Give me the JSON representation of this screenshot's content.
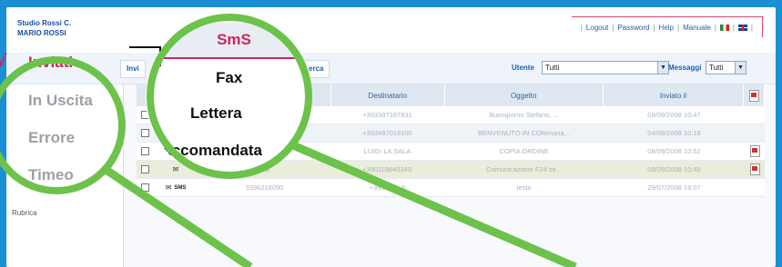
{
  "header": {
    "company_line1": "Studio Rossi C.",
    "company_line2": "MARIO ROSSI",
    "nav": [
      "Logout",
      "Password",
      "Help",
      "Manuale"
    ]
  },
  "tabs": {
    "partial_left": "Invi",
    "partial_right": "erca"
  },
  "filters": {
    "utente_label": "Utente",
    "utente_value": "Tutti",
    "messaggi_label": "Messaggi",
    "messaggi_value": "Tutti"
  },
  "sidebar": {
    "rubrica": "Rubrica"
  },
  "left_menu": {
    "items": [
      "Inviati",
      "In Uscita",
      "Errore",
      "Timeo"
    ]
  },
  "type_menu": {
    "items": [
      "SmS",
      "Fax",
      "Lettera",
      "Raccomandata"
    ]
  },
  "table": {
    "headers": [
      "Destinatario",
      "Oggetto",
      "Inviato il"
    ],
    "rows": [
      {
        "mitt": "",
        "dest": "+393387167831",
        "ogg": "Buongiorno Stefano, ...",
        "inv": "08/09/2008 10:47",
        "type": "",
        "pdf": false
      },
      {
        "mitt": "",
        "dest": "+393487019100",
        "ogg": "BENVENUTO IN COMmana...",
        "inv": "04/09/2008 10:18",
        "type": "",
        "pdf": false
      },
      {
        "mitt": "",
        "dest": "LUIGI LA SALA",
        "ogg": "COPIA ORDINE",
        "inv": "08/09/2008 10:52",
        "type": "",
        "pdf": true
      },
      {
        "mitt": "olui",
        "dest": "+39011984034S",
        "ogg": "Comunicazione F24 se...",
        "inv": "08/09/2008 10:49",
        "type": "",
        "pdf": true
      },
      {
        "mitt": "3398216090",
        "dest": "+393368...6",
        "ogg": "testo",
        "inv": "29/07/2008 19:07",
        "type": "SMS",
        "pdf": false
      }
    ]
  },
  "colors": {
    "accent": "#d3245c",
    "circle": "#6cc24a",
    "frame": "#1a8fd3"
  }
}
